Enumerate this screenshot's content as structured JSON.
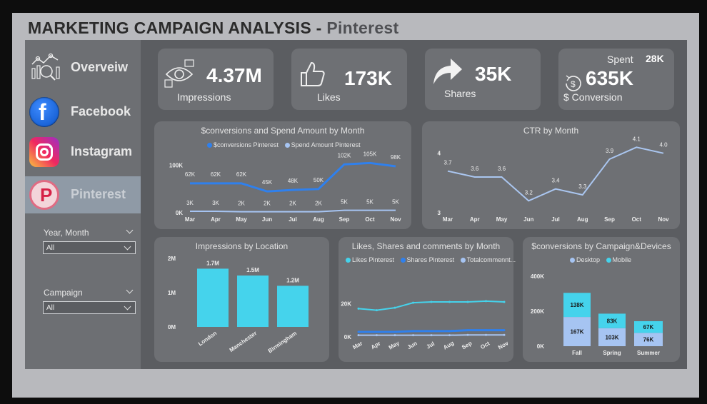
{
  "dashboard": {
    "title": "MARKETING CAMPAIGN ANALYSIS -",
    "subtitle": "Pinterest"
  },
  "sidebar": {
    "items": [
      {
        "label": "Overveiw",
        "icon": "analytics-icon"
      },
      {
        "label": "Facebook",
        "icon": "facebook-icon"
      },
      {
        "label": "Instagram",
        "icon": "instagram-icon"
      },
      {
        "label": "Pinterest",
        "icon": "pinterest-icon",
        "active": true
      }
    ],
    "filters": [
      {
        "label": "Year, Month",
        "value": "All"
      },
      {
        "label": "Campaign",
        "value": "All"
      }
    ]
  },
  "kpis": {
    "impressions": {
      "value": "4.37M",
      "label": "Impressions"
    },
    "likes": {
      "value": "173K",
      "label": "Likes"
    },
    "shares": {
      "value": "35K",
      "label": "Shares"
    },
    "conversion": {
      "value": "635K",
      "label": "$ Conversion",
      "spent_label": "Spent",
      "spent_value": "28K"
    }
  },
  "colors": {
    "series_dark": "#2f80ed",
    "series_light": "#a6c4f2",
    "series_cyan": "#45d3ec",
    "ctr_line": "#aac6f0"
  },
  "chart_data": [
    {
      "type": "line",
      "title": "$conversions and Spend Amount by Month",
      "categories": [
        "Mar",
        "Apr",
        "May",
        "Jun",
        "Jul",
        "Aug",
        "Sep",
        "Oct",
        "Nov"
      ],
      "series": [
        {
          "name": "$conversions Pinterest",
          "values": [
            62000,
            62000,
            62000,
            45000,
            48000,
            50000,
            102000,
            105000,
            98000
          ],
          "labels": [
            "62K",
            "62K",
            "62K",
            "45K",
            "48K",
            "50K",
            "102K",
            "105K",
            "98K"
          ]
        },
        {
          "name": "Spend Amount Pinterest",
          "values": [
            3000,
            3000,
            2000,
            2000,
            2000,
            2000,
            5000,
            5000,
            5000
          ],
          "labels": [
            "3K",
            "3K",
            "2K",
            "2K",
            "2K",
            "2K",
            "5K",
            "5K",
            "5K"
          ]
        }
      ],
      "yticks": [
        "0K",
        "100K"
      ],
      "ylim": [
        0,
        110000
      ]
    },
    {
      "type": "line",
      "title": "CTR by Month",
      "categories": [
        "Mar",
        "Apr",
        "May",
        "Jun",
        "Jul",
        "Aug",
        "Sep",
        "Oct",
        "Nov"
      ],
      "series": [
        {
          "values": [
            3.7,
            3.6,
            3.6,
            3.2,
            3.4,
            3.3,
            3.9,
            4.1,
            4.0
          ],
          "labels": [
            "3.7",
            "3.6",
            "3.6",
            "3.2",
            "3.4",
            "3.3",
            "3.9",
            "4.1",
            "4.0"
          ]
        }
      ],
      "yticks": [
        "3",
        "4"
      ],
      "ylim": [
        3,
        4.2
      ]
    },
    {
      "type": "bar",
      "title": "Impressions by Location",
      "categories": [
        "London",
        "Manchester",
        "Birmingham"
      ],
      "values": [
        1700000,
        1500000,
        1200000
      ],
      "labels": [
        "1.7M",
        "1.5M",
        "1.2M"
      ],
      "yticks": [
        "0M",
        "1M",
        "2M"
      ],
      "ylim": [
        0,
        2000000
      ]
    },
    {
      "type": "line",
      "title": "Likes, Shares and comments by Month",
      "categories": [
        "Mar",
        "Apr",
        "May",
        "Jun",
        "Jul",
        "Aug",
        "Sep",
        "Oct",
        "Nov"
      ],
      "series": [
        {
          "name": "Likes Pinterest",
          "values": [
            17000,
            16000,
            17500,
            20500,
            21000,
            21000,
            21000,
            21500,
            21000
          ]
        },
        {
          "name": "Shares Pinterest",
          "values": [
            3000,
            3000,
            3000,
            3500,
            3500,
            3500,
            4000,
            4000,
            4000
          ]
        },
        {
          "name": "Totalcommennt...",
          "values": [
            1000,
            1000,
            1000,
            1000,
            1000,
            1000,
            1200,
            1200,
            1200
          ]
        }
      ],
      "yticks": [
        "0K",
        "20K"
      ],
      "ylim": [
        0,
        30000
      ]
    },
    {
      "type": "bar",
      "title": "$conversions by Campaign&Devices",
      "categories": [
        "Fall",
        "Spring",
        "Summer"
      ],
      "series": [
        {
          "name": "Desktop",
          "values": [
            167000,
            103000,
            76000
          ],
          "labels": [
            "167K",
            "103K",
            "76K"
          ]
        },
        {
          "name": "Mobile",
          "values": [
            138000,
            83000,
            67000
          ],
          "labels": [
            "138K",
            "83K",
            "67K"
          ]
        }
      ],
      "yticks": [
        "0K",
        "200K",
        "400K"
      ],
      "ylim": [
        0,
        400000
      ]
    }
  ]
}
